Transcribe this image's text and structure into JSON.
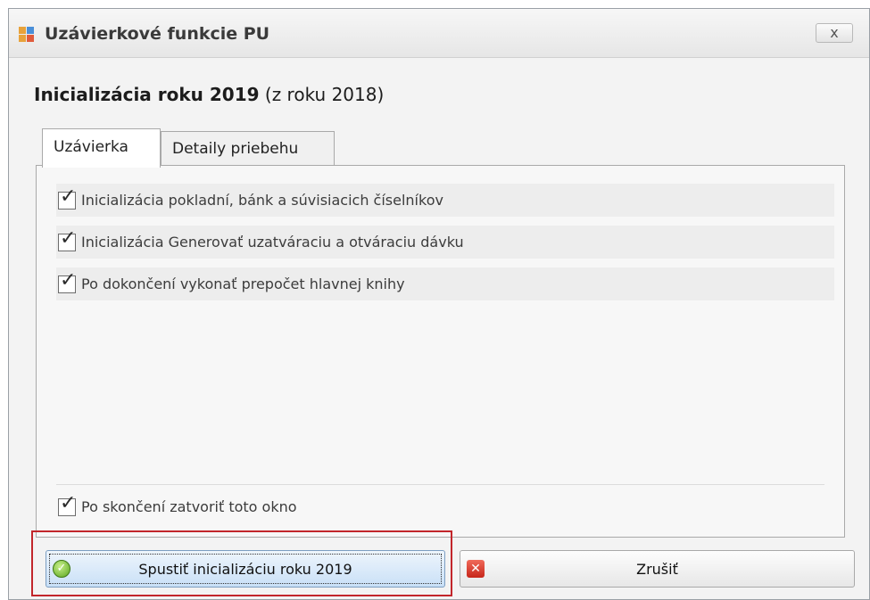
{
  "window": {
    "title": "Uzávierkové funkcie PU",
    "close_label": "x"
  },
  "header": {
    "title_bold": "Inicializácia roku 2019",
    "title_suffix": " (z roku 2018)"
  },
  "tabs": [
    {
      "label": "Uzávierka",
      "active": true
    },
    {
      "label": "Detaily priebehu",
      "active": false
    }
  ],
  "options": [
    {
      "label": "Inicializácia pokladní, bánk a súvisiacich číselníkov",
      "checked": true
    },
    {
      "label": "Inicializácia Generovať uzatváraciu a otváraciu dávku",
      "checked": true
    },
    {
      "label": "Po dokončení vykonať prepočet hlavnej knihy",
      "checked": true
    }
  ],
  "close_after": {
    "label": "Po skončení zatvoriť toto okno",
    "checked": true
  },
  "buttons": {
    "start_label": "Spustiť inicializáciu roku 2019",
    "cancel_label": "Zrušiť"
  },
  "icons": {
    "app": "app-window-icon",
    "start": "ok-check-icon",
    "cancel": "cancel-x-icon"
  },
  "colors": {
    "highlight_border": "#c2262b",
    "start_button_tint": "#c9e0f7"
  }
}
